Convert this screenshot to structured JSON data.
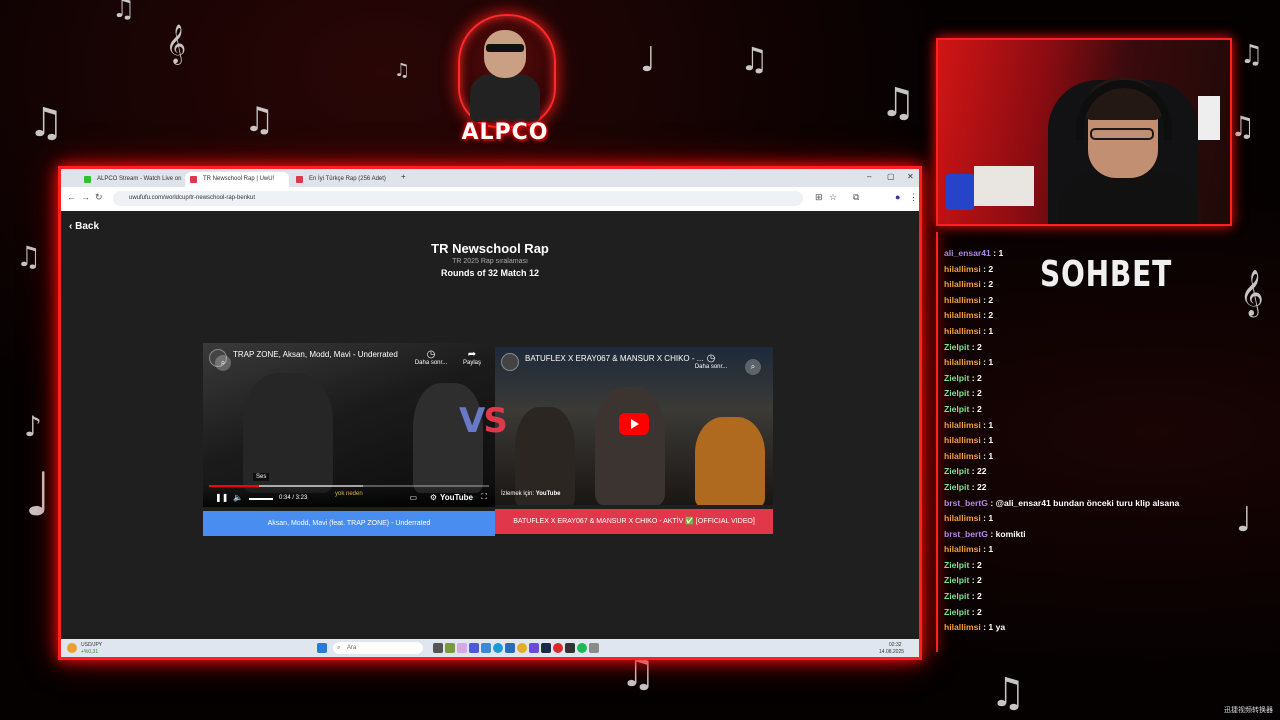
{
  "theme": {
    "accent": "#ff2020",
    "blue_choice": "#4a8df0",
    "red_choice": "#e0384a"
  },
  "logo": {
    "text": "ALPCO"
  },
  "browser": {
    "tabs": [
      {
        "label": "ALPCO Stream - Watch Live on",
        "favicon_color": "#2dc22d"
      },
      {
        "label": "TR Newschool Rap | UwU!",
        "favicon_color": "#e0384a"
      },
      {
        "label": "En İyi Türkçe Rap (256 Adet)",
        "favicon_color": "#e0384a"
      }
    ],
    "new_tab": "+",
    "url": "uwufufu.com/worldcup/tr-newschool-rap-benkut"
  },
  "page": {
    "back_label": "Back",
    "title": "TR Newschool Rap",
    "subtitle": "TR 2025 Rap sıralaması",
    "round": "Rounds of 32 Match 12",
    "vs_v": "V",
    "vs_s": "S"
  },
  "video_left": {
    "title": "TRAP ZONE, Aksan, Modd, Mavi - Underrated",
    "watch_later": "Daha sonr...",
    "share": "Paylaş",
    "tooltip": "Ses",
    "time": "0:34 / 3:23",
    "progress_fraction": 0.18,
    "logo": "YouTube",
    "caption": "yok neden",
    "choice": "Aksan, Modd, Mavi (feat. TRAP ZONE) - Underrated"
  },
  "video_right": {
    "title": "BATUFLEX X ERAY067 & MANSUR X CHIKO - ...",
    "watch_later": "Daha sonr...",
    "watch_on": "İzlemek için:",
    "logo": "YouTube",
    "choice": "BATUFLEX X ERAY067 & MANSUR X CHIKO - AKTİV ✅ [OFFICIAL VIDEO]"
  },
  "taskbar": {
    "weather_temp": "USD/JPY",
    "weather_sub": "+%0,31",
    "search": "Ara",
    "clock_time": "02:32",
    "clock_date": "14.08.2025"
  },
  "chat": {
    "header": "SOHBET",
    "messages": [
      {
        "user": "ali_ensar41",
        "text": " : 1",
        "color": "#a98ae0"
      },
      {
        "user": "hilallimsi",
        "text": " : 2",
        "color": "#f0a040"
      },
      {
        "user": "hilallimsi",
        "text": " : 2",
        "color": "#f0a040"
      },
      {
        "user": "hilallimsi",
        "text": " : 2",
        "color": "#f0a040"
      },
      {
        "user": "hilallimsi",
        "text": " : 2",
        "color": "#f0a040"
      },
      {
        "user": "hilallimsi",
        "text": " : 1",
        "color": "#f0a040"
      },
      {
        "user": "Zielpit",
        "text": " : 2",
        "color": "#7be28f"
      },
      {
        "user": "hilallimsi",
        "text": " : 1",
        "color": "#f0a040"
      },
      {
        "user": "Zielpit",
        "text": " : 2",
        "color": "#7be28f"
      },
      {
        "user": "Zielpit",
        "text": " : 2",
        "color": "#7be28f"
      },
      {
        "user": "Zielpit",
        "text": " : 2",
        "color": "#7be28f"
      },
      {
        "user": "hilallimsi",
        "text": " : 1",
        "color": "#f0a040"
      },
      {
        "user": "hilallimsi",
        "text": " : 1",
        "color": "#f0a040"
      },
      {
        "user": "hilallimsi",
        "text": " : 1",
        "color": "#f0a040"
      },
      {
        "user": "Zielpit",
        "text": " : 22",
        "color": "#7be28f"
      },
      {
        "user": "Zielpit",
        "text": " : 22",
        "color": "#7be28f"
      },
      {
        "user": "brst_bertG",
        "text": " : @ali_ensar41 bundan önceki turu klip alsana",
        "color": "#b48ae8"
      },
      {
        "user": "hilallimsi",
        "text": " : 1",
        "color": "#f0a040"
      },
      {
        "user": "brst_bertG",
        "text": " : komikti",
        "color": "#b48ae8"
      },
      {
        "user": "hilallimsi",
        "text": " : 1",
        "color": "#f0a040"
      },
      {
        "user": "Zielpit",
        "text": " : 2",
        "color": "#7be28f"
      },
      {
        "user": "Zielpit",
        "text": " : 2",
        "color": "#7be28f"
      },
      {
        "user": "Zielpit",
        "text": " : 2",
        "color": "#7be28f"
      },
      {
        "user": "Zielpit",
        "text": " : 2",
        "color": "#7be28f"
      },
      {
        "user": "hilallimsi",
        "text": " : 1 ya",
        "color": "#f0a040"
      }
    ]
  },
  "watermark": "迅捷视频转换器"
}
